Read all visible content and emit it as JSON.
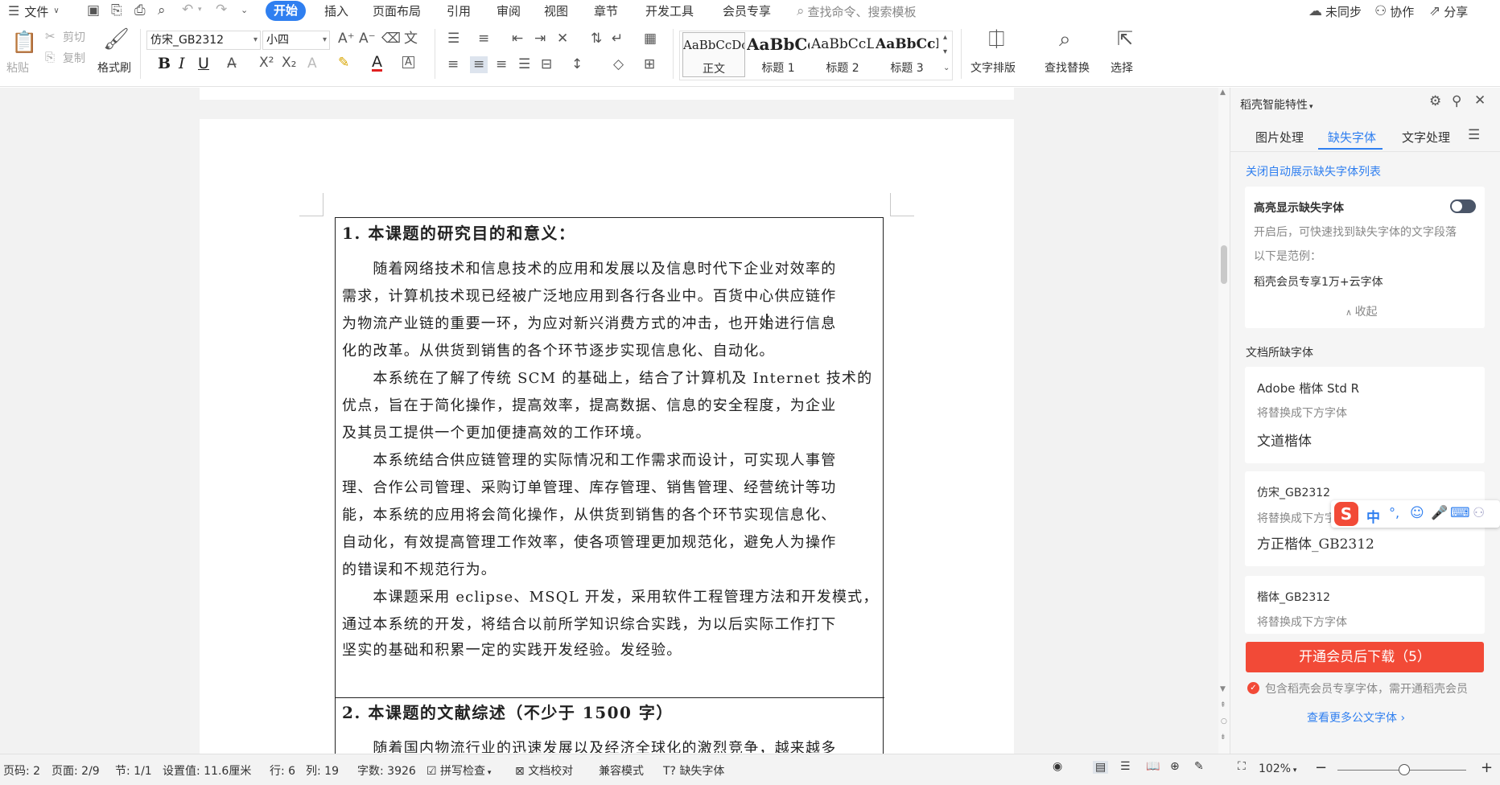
{
  "menubar": {
    "file_label": "文件",
    "tabs": [
      "开始",
      "插入",
      "页面布局",
      "引用",
      "审阅",
      "视图",
      "章节",
      "开发工具",
      "会员专享"
    ],
    "active_tab": "开始",
    "search_placeholder": "查找命令、搜索模板",
    "sync_label": "未同步",
    "collab_label": "协作",
    "share_label": "分享"
  },
  "ribbon": {
    "paste_label": "粘贴",
    "cut_label": "剪切",
    "copy_label": "复制",
    "format_painter_label": "格式刷",
    "font_name": "仿宋_GB2312",
    "font_size": "小四",
    "styles": [
      {
        "sample": "AaBbCcDc",
        "label": "正文"
      },
      {
        "sample": "AaBbCc",
        "label": "标题 1"
      },
      {
        "sample": "AaBbCcL",
        "label": "标题 2"
      },
      {
        "sample": "AaBbCcI",
        "label": "标题 3"
      }
    ],
    "text_layout_label": "文字排版",
    "find_replace_label": "查找替换",
    "select_label": "选择"
  },
  "document": {
    "heading1": "1. 本课题的研究目的和意义：",
    "paragraph_lines": [
      "　　随着网络技术和信息技术的应用和发展以及信息时代下企业对效率的",
      "需求，计算机技术现已经被广泛地应用到各行各业中。百货中心供应链作",
      "为物流产业链的重要一环，为应对新兴消费方式的冲击，也开始进行信息",
      "化的改革。从供货到销售的各个环节逐步实现信息化、自动化。",
      "　　本系统在了解了传统 SCM 的基础上，结合了计算机及 Internet 技术的",
      "优点，旨在于简化操作，提高效率，提高数据、信息的安全程度，为企业",
      "及其员工提供一个更加便捷高效的工作环境。",
      "　　本系统结合供应链管理的实际情况和工作需求而设计，可实现人事管",
      "理、合作公司管理、采购订单管理、库存管理、销售管理、经营统计等功",
      "能，本系统的应用将会简化操作，从供货到销售的各个环节实现信息化、",
      "自动化，有效提高管理工作效率，使各项管理更加规范化，避免人为操作",
      "的错误和不规范行为。",
      "　　本课题采用 eclipse、MSQL 开发，采用软件工程管理方法和开发模式，",
      "通过本系统的开发，将结合以前所学知识综合实践，为以后实际工作打下",
      "坚实的基础和积累一定的实践开发经验。发经验。"
    ],
    "heading2": "2. 本课题的文献综述（不少于 1500 字）",
    "paragraph2_line": "　　随着国内物流行业的迅速发展以及经济全球化的激烈竞争，越来越多"
  },
  "panel": {
    "title": "稻壳智能特性",
    "tabs": [
      "图片处理",
      "缺失字体",
      "文字处理"
    ],
    "active_tab": "缺失字体",
    "close_auto_link": "关闭自动展示缺失字体列表",
    "highlight_title": "高亮显示缺失字体",
    "highlight_desc": "开启后，可快速找到缺失字体的文字段落",
    "example_label": "以下是范例：",
    "example_text": "稻壳会员专享1万+云字体",
    "collapse_label": "收起",
    "missing_section_title": "文档所缺字体",
    "missing_fonts": [
      {
        "name": "Adobe 楷体 Std R",
        "hint": "将替换成下方字体",
        "replacement": "文道楷体"
      },
      {
        "name": "仿宋_GB2312",
        "hint": "将替换成下方字",
        "replacement": "方正楷体_GB2312"
      },
      {
        "name": "楷体_GB2312",
        "hint": "将替换成下方字体",
        "replacement": ""
      }
    ],
    "download_button": "开通会员后下载（5）",
    "member_note": "包含稻壳会员专享字体，需开通稻壳会员",
    "more_link": "查看更多公文字体 ›",
    "ime_label": "中"
  },
  "status": {
    "page_num": "页码: 2",
    "page_of": "页面: 2/9",
    "section": "节: 1/1",
    "setting": "设置值: 11.6厘米",
    "row": "行: 6",
    "col": "列: 19",
    "word_count": "字数: 3926",
    "spell_check": "拼写检查",
    "doc_proof": "文档校对",
    "compat_mode": "兼容模式",
    "missing_font": "缺失字体",
    "zoom": "102%"
  },
  "colors": {
    "accent": "#2f7ff0",
    "download_button": "#f24a37"
  }
}
